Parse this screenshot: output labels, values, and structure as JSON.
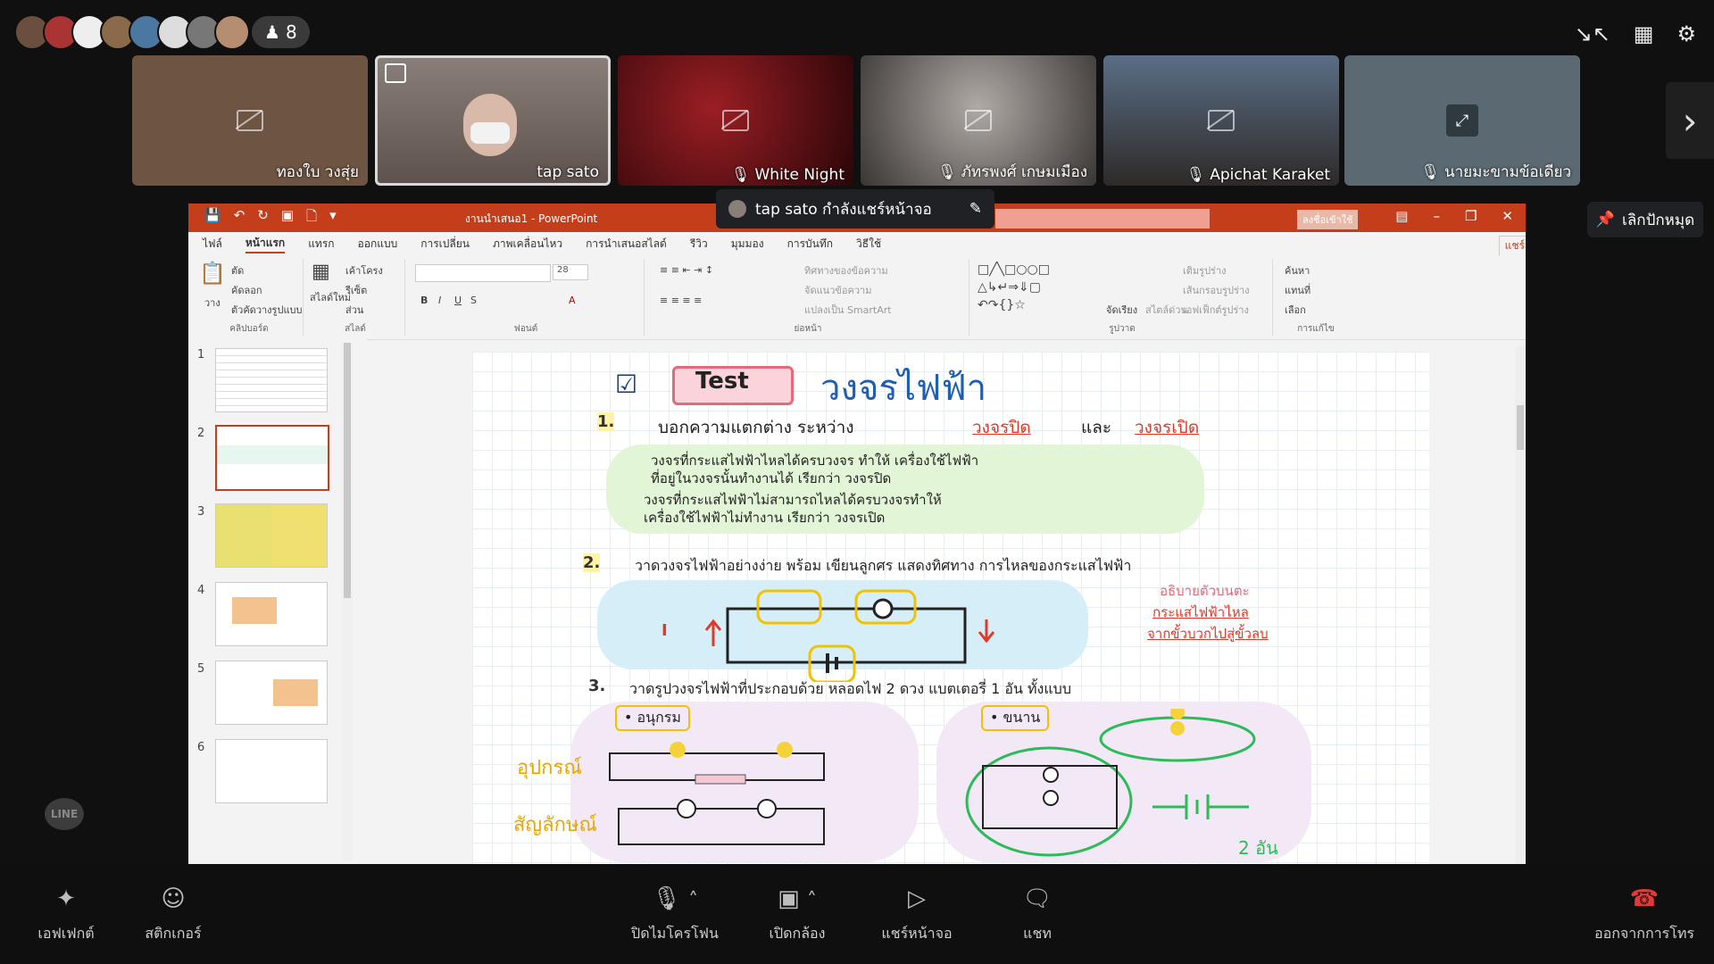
{
  "participants": {
    "count": "8",
    "avatar_colors": [
      "#6b4e3d",
      "#a33",
      "#eeeeee",
      "#8a6a4a",
      "#4a78a0",
      "#dddddd",
      "#777777",
      "#b58d70"
    ]
  },
  "top_icons": [
    "exit-fullscreen-icon",
    "apps-grid-icon",
    "settings-gear-icon"
  ],
  "tiles": [
    {
      "name": "ทองใบ วงสุ่ย",
      "muted": false,
      "color": "#6e5442"
    },
    {
      "name": "tap sato",
      "muted": false,
      "color": "#7a6a62"
    },
    {
      "name": "White Night",
      "muted": true,
      "color": "#4a0c10"
    },
    {
      "name": "ภัทรพงศ์ เกษมเมือง",
      "muted": true,
      "color": "#8a8480"
    },
    {
      "name": "Apichat Karaket",
      "muted": true,
      "color": "#3e4450"
    },
    {
      "name": "นายมะขามข้อเดียว",
      "muted": true,
      "color": "#5b6a72"
    }
  ],
  "share_banner": {
    "text": "tap sato กำลังแชร์หน้าจอ"
  },
  "stop_button": {
    "label": "เลิกปักหมุด"
  },
  "ppt": {
    "document_title": "งานนำเสนอ1  -  PowerPoint",
    "sign_in": "ลงชื่อเข้าใช้",
    "share_label": "แชร์",
    "tabs": [
      "ไฟล์",
      "หน้าแรก",
      "แทรก",
      "ออกแบบ",
      "การเปลี่ยน",
      "ภาพเคลื่อนไหว",
      "การนำเสนอสไลด์",
      "รีวิว",
      "มุมมอง",
      "การบันทึก",
      "วิธีใช้"
    ],
    "groups": {
      "clipboard": {
        "label": "คลิปบอร์ด",
        "paste": "วาง",
        "cut": "ตัด",
        "copy": "คัดลอก",
        "format_painter": "ตัวคัดวางรูปแบบ"
      },
      "slides": {
        "label": "สไลด์",
        "new_slide": "สไลด์ใหม่",
        "layout": "เค้าโครง",
        "reset": "รีเซ็ต",
        "section": "ส่วน"
      },
      "font": {
        "label": "ฟอนต์",
        "size": "28"
      },
      "paragraph": {
        "label": "ย่อหน้า",
        "text_direction": "ทิศทางของข้อความ",
        "align_text": "จัดแนวข้อความ",
        "smartart": "แปลงเป็น SmartArt"
      },
      "drawing": {
        "label": "รูปวาด",
        "arrange": "จัดเรียง",
        "quick_styles": "สไตล์ด่วน",
        "fill": "เติมรูปร่าง",
        "outline": "เส้นกรอบรูปร่าง",
        "effects": "เอฟเฟ็กต์รูปร่าง"
      },
      "editing": {
        "label": "การแก้ไข",
        "find": "ค้นหา",
        "replace": "แทนที่",
        "select": "เลือก"
      }
    },
    "slide_numbers": [
      "1",
      "2",
      "3",
      "4",
      "5",
      "6"
    ],
    "selected_slide": "2"
  },
  "slide": {
    "test_label": "Test",
    "title": "วงจรไฟฟ้า",
    "q1": {
      "num": "1.",
      "text": "บอกความแตกต่าง ระหว่าง",
      "closed": "วงจรปิด",
      "and": "และ",
      "open": "วงจรเปิด"
    },
    "a1": [
      "วงจรที่กระแสไฟฟ้าไหลได้ครบวงจร ทำให้ เครื่องใช้ไฟฟ้า",
      "ที่อยู่ในวงจรนั้นทำงานได้  เรียกว่า  วงจรปิด",
      "วงจรที่กระแสไฟฟ้าไม่สามารถไหลได้ครบวงจรทำให้",
      "เครื่องใช้ไฟฟ้าไม่ทำงาน  เรียกว่า  วงจรเปิด"
    ],
    "q2": {
      "num": "2.",
      "text": "วาดวงจรไฟฟ้าอย่างง่าย พร้อม เขียนลูกศร แสดงทิศทาง การไหลของกระแสไฟฟ้า"
    },
    "a2": {
      "symbol": "I",
      "note": [
        "อธิบายตัวบนตะ",
        "กระแสไฟฟ้าไหล",
        "จากขั้วบวกไปสู่ขั้วลบ"
      ]
    },
    "q3": {
      "num": "3.",
      "text": "วาดรูปวงจรไฟฟ้าที่ประกอบด้วย หลอดไฟ 2 ดวง แบตเตอรี่ 1 อัน ทั้งแบบ"
    },
    "series_label": "• อนุกรม",
    "parallel_label": "• ขนาน",
    "equipment": "อุปกรณ์",
    "symbol": "สัญลักษณ์",
    "two_cells": "2 อัน"
  },
  "line_badge": "LINE",
  "bottom_controls": [
    {
      "id": "effects",
      "label": "เอฟเฟกต์",
      "icon": "sparkle-icon"
    },
    {
      "id": "stickers",
      "label": "สติกเกอร์",
      "icon": "smiley-icon"
    },
    {
      "id": "mic",
      "label": "ปิดไมโครโฟน",
      "icon": "microphone-icon"
    },
    {
      "id": "camera",
      "label": "เปิดกล้อง",
      "icon": "camera-off-icon"
    },
    {
      "id": "share",
      "label": "แชร์หน้าจอ",
      "icon": "share-screen-icon"
    },
    {
      "id": "chat",
      "label": "แชท",
      "icon": "chat-bubble-icon"
    },
    {
      "id": "leave",
      "label": "ออกจากการโทร",
      "icon": "hang-up-icon"
    }
  ]
}
